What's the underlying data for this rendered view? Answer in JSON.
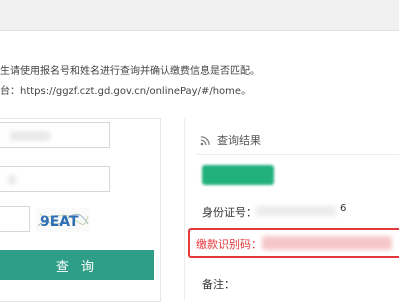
{
  "notice": {
    "text": "生请使用报名号和姓名进行查询并确认缴费信息是否匹配。",
    "url_text": "台：https://ggzf.czt.gd.gov.cn/onlinePay/#/home。"
  },
  "form": {
    "captcha_text": "9EAT",
    "query_button_label": "查 询"
  },
  "result": {
    "header_icon": "rss-icon",
    "header_title": "查询结果",
    "id_label": "身份证号：",
    "id_suffix": "6",
    "payment_code_label": "缴款识别码：",
    "remark_label": "备注："
  },
  "colors": {
    "accent": "#2e9e88",
    "status_green": "#22b07d",
    "highlight_red": "#e5383b"
  }
}
